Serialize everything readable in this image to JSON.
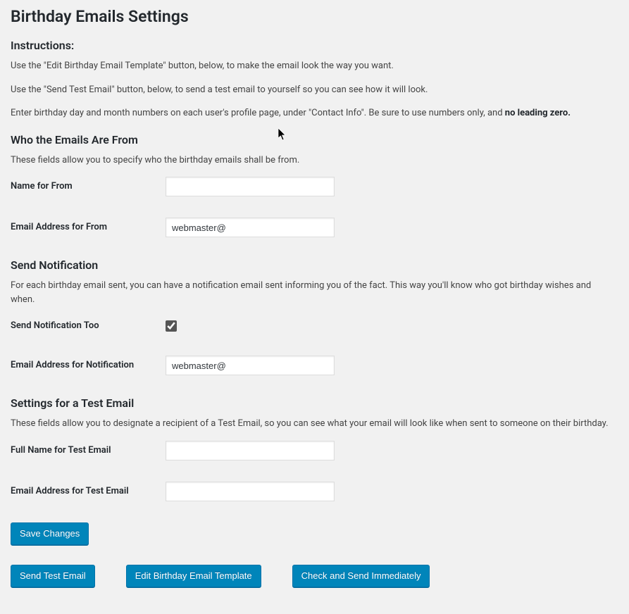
{
  "page_title": "Birthday Emails Settings",
  "instructions": {
    "heading": "Instructions:",
    "p1": "Use the \"Edit Birthday Email Template\" button, below, to make the email look the way you want.",
    "p2": "Use the \"Send Test Email\" button, below, to send a test email to yourself so you can see how it will look.",
    "p3_a": "Enter birthday day and month numbers on each user's profile page, under \"Contact Info\". Be sure to use numbers only, and ",
    "p3_b": "no leading zero."
  },
  "from": {
    "heading": "Who the Emails Are From",
    "desc": "These fields allow you to specify who the birthday emails shall be from.",
    "name_label": "Name for From",
    "name_value": "",
    "email_label": "Email Address for From",
    "email_value": "webmaster@"
  },
  "notify": {
    "heading": "Send Notification",
    "desc": "For each birthday email sent, you can have a notification email sent informing you of the fact. This way you'll know who got birthday wishes and when.",
    "toggle_label": "Send Notification Too",
    "toggle_checked": true,
    "email_label": "Email Address for Notification",
    "email_value": "webmaster@"
  },
  "test": {
    "heading": "Settings for a Test Email",
    "desc": "These fields allow you to designate a recipient of a Test Email, so you can see what your email will look like when sent to someone on their birthday.",
    "name_label": "Full Name for Test Email",
    "name_value": "",
    "email_label": "Email Address for Test Email",
    "email_value": ""
  },
  "buttons": {
    "save": "Save Changes",
    "send_test": "Send Test Email",
    "edit_template": "Edit Birthday Email Template",
    "check_send": "Check and Send Immediately"
  }
}
